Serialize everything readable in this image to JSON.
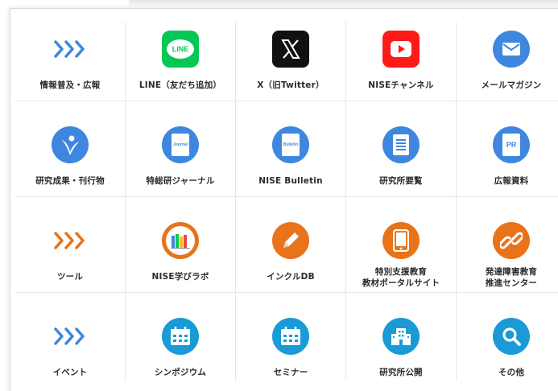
{
  "colors": {
    "accent_blue": "#3f86de",
    "orange": "#e8731a",
    "line_green": "#06c755",
    "x_black": "#111111",
    "youtube_red": "#ff0000",
    "text": "#2b2b2b"
  },
  "grid": {
    "rows": [
      [
        {
          "label": "情報普及・広報",
          "icon": "chevron-triple-icon"
        },
        {
          "label": "LINE（友だち追加）",
          "icon": "line-logo-icon",
          "icon_text": "LINE"
        },
        {
          "label": "X（旧Twitter）",
          "icon": "x-logo-icon",
          "icon_text": "𝕏"
        },
        {
          "label": "NISEチャンネル",
          "icon": "youtube-icon"
        },
        {
          "label": "メールマガジン",
          "icon": "mail-icon"
        }
      ],
      [
        {
          "label": "研究成果・刊行物",
          "icon": "nise-logo-icon"
        },
        {
          "label": "特総研ジャーナル",
          "icon": "journal-icon",
          "icon_text": "Journal"
        },
        {
          "label": "NISE Bulletin",
          "icon": "bulletin-icon",
          "icon_text": "Bulletin"
        },
        {
          "label": "研究所要覧",
          "icon": "document-icon"
        },
        {
          "label": "広報資料",
          "icon": "pr-icon",
          "icon_text": "PR"
        }
      ],
      [
        {
          "label": "ツール",
          "icon": "chevron-triple-icon"
        },
        {
          "label": "NISE学びラボ",
          "icon": "books-icon"
        },
        {
          "label": "インクルDB",
          "icon": "pencil-icon"
        },
        {
          "label": "特別支援教育",
          "label2": "教材ポータルサイト",
          "icon": "tablet-icon"
        },
        {
          "label": "発達障害教育",
          "label2": "推進センター",
          "icon": "link-icon"
        }
      ],
      [
        {
          "label": "イベント",
          "icon": "chevron-triple-icon"
        },
        {
          "label": "シンポジウム",
          "icon": "calendar-icon"
        },
        {
          "label": "セミナー",
          "icon": "calendar-icon"
        },
        {
          "label": "研究所公開",
          "icon": "building-icon"
        },
        {
          "label": "その他",
          "icon": "search-icon"
        }
      ]
    ]
  }
}
